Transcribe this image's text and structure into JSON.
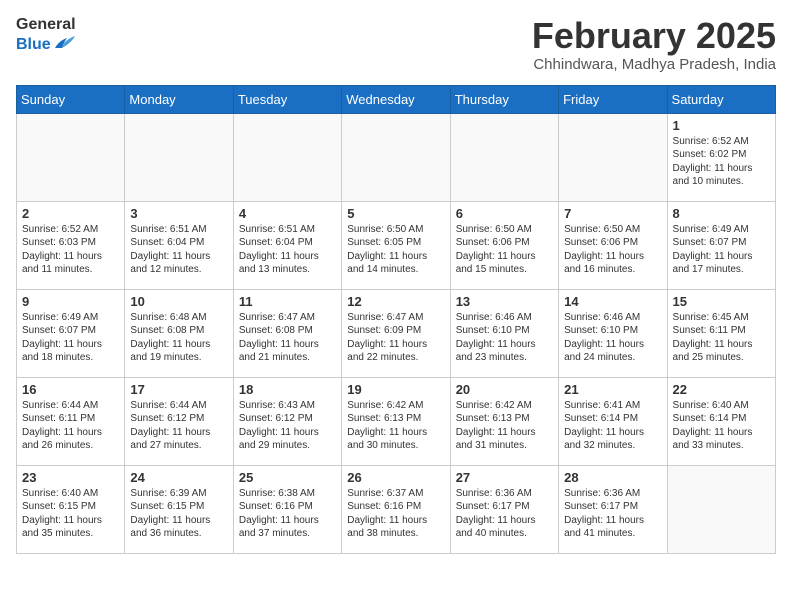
{
  "header": {
    "logo_general": "General",
    "logo_blue": "Blue",
    "month_title": "February 2025",
    "location": "Chhindwara, Madhya Pradesh, India"
  },
  "weekdays": [
    "Sunday",
    "Monday",
    "Tuesday",
    "Wednesday",
    "Thursday",
    "Friday",
    "Saturday"
  ],
  "weeks": [
    [
      {
        "day": "",
        "info": ""
      },
      {
        "day": "",
        "info": ""
      },
      {
        "day": "",
        "info": ""
      },
      {
        "day": "",
        "info": ""
      },
      {
        "day": "",
        "info": ""
      },
      {
        "day": "",
        "info": ""
      },
      {
        "day": "1",
        "info": "Sunrise: 6:52 AM\nSunset: 6:02 PM\nDaylight: 11 hours\nand 10 minutes."
      }
    ],
    [
      {
        "day": "2",
        "info": "Sunrise: 6:52 AM\nSunset: 6:03 PM\nDaylight: 11 hours\nand 11 minutes."
      },
      {
        "day": "3",
        "info": "Sunrise: 6:51 AM\nSunset: 6:04 PM\nDaylight: 11 hours\nand 12 minutes."
      },
      {
        "day": "4",
        "info": "Sunrise: 6:51 AM\nSunset: 6:04 PM\nDaylight: 11 hours\nand 13 minutes."
      },
      {
        "day": "5",
        "info": "Sunrise: 6:50 AM\nSunset: 6:05 PM\nDaylight: 11 hours\nand 14 minutes."
      },
      {
        "day": "6",
        "info": "Sunrise: 6:50 AM\nSunset: 6:06 PM\nDaylight: 11 hours\nand 15 minutes."
      },
      {
        "day": "7",
        "info": "Sunrise: 6:50 AM\nSunset: 6:06 PM\nDaylight: 11 hours\nand 16 minutes."
      },
      {
        "day": "8",
        "info": "Sunrise: 6:49 AM\nSunset: 6:07 PM\nDaylight: 11 hours\nand 17 minutes."
      }
    ],
    [
      {
        "day": "9",
        "info": "Sunrise: 6:49 AM\nSunset: 6:07 PM\nDaylight: 11 hours\nand 18 minutes."
      },
      {
        "day": "10",
        "info": "Sunrise: 6:48 AM\nSunset: 6:08 PM\nDaylight: 11 hours\nand 19 minutes."
      },
      {
        "day": "11",
        "info": "Sunrise: 6:47 AM\nSunset: 6:08 PM\nDaylight: 11 hours\nand 21 minutes."
      },
      {
        "day": "12",
        "info": "Sunrise: 6:47 AM\nSunset: 6:09 PM\nDaylight: 11 hours\nand 22 minutes."
      },
      {
        "day": "13",
        "info": "Sunrise: 6:46 AM\nSunset: 6:10 PM\nDaylight: 11 hours\nand 23 minutes."
      },
      {
        "day": "14",
        "info": "Sunrise: 6:46 AM\nSunset: 6:10 PM\nDaylight: 11 hours\nand 24 minutes."
      },
      {
        "day": "15",
        "info": "Sunrise: 6:45 AM\nSunset: 6:11 PM\nDaylight: 11 hours\nand 25 minutes."
      }
    ],
    [
      {
        "day": "16",
        "info": "Sunrise: 6:44 AM\nSunset: 6:11 PM\nDaylight: 11 hours\nand 26 minutes."
      },
      {
        "day": "17",
        "info": "Sunrise: 6:44 AM\nSunset: 6:12 PM\nDaylight: 11 hours\nand 27 minutes."
      },
      {
        "day": "18",
        "info": "Sunrise: 6:43 AM\nSunset: 6:12 PM\nDaylight: 11 hours\nand 29 minutes."
      },
      {
        "day": "19",
        "info": "Sunrise: 6:42 AM\nSunset: 6:13 PM\nDaylight: 11 hours\nand 30 minutes."
      },
      {
        "day": "20",
        "info": "Sunrise: 6:42 AM\nSunset: 6:13 PM\nDaylight: 11 hours\nand 31 minutes."
      },
      {
        "day": "21",
        "info": "Sunrise: 6:41 AM\nSunset: 6:14 PM\nDaylight: 11 hours\nand 32 minutes."
      },
      {
        "day": "22",
        "info": "Sunrise: 6:40 AM\nSunset: 6:14 PM\nDaylight: 11 hours\nand 33 minutes."
      }
    ],
    [
      {
        "day": "23",
        "info": "Sunrise: 6:40 AM\nSunset: 6:15 PM\nDaylight: 11 hours\nand 35 minutes."
      },
      {
        "day": "24",
        "info": "Sunrise: 6:39 AM\nSunset: 6:15 PM\nDaylight: 11 hours\nand 36 minutes."
      },
      {
        "day": "25",
        "info": "Sunrise: 6:38 AM\nSunset: 6:16 PM\nDaylight: 11 hours\nand 37 minutes."
      },
      {
        "day": "26",
        "info": "Sunrise: 6:37 AM\nSunset: 6:16 PM\nDaylight: 11 hours\nand 38 minutes."
      },
      {
        "day": "27",
        "info": "Sunrise: 6:36 AM\nSunset: 6:17 PM\nDaylight: 11 hours\nand 40 minutes."
      },
      {
        "day": "28",
        "info": "Sunrise: 6:36 AM\nSunset: 6:17 PM\nDaylight: 11 hours\nand 41 minutes."
      },
      {
        "day": "",
        "info": ""
      }
    ]
  ]
}
